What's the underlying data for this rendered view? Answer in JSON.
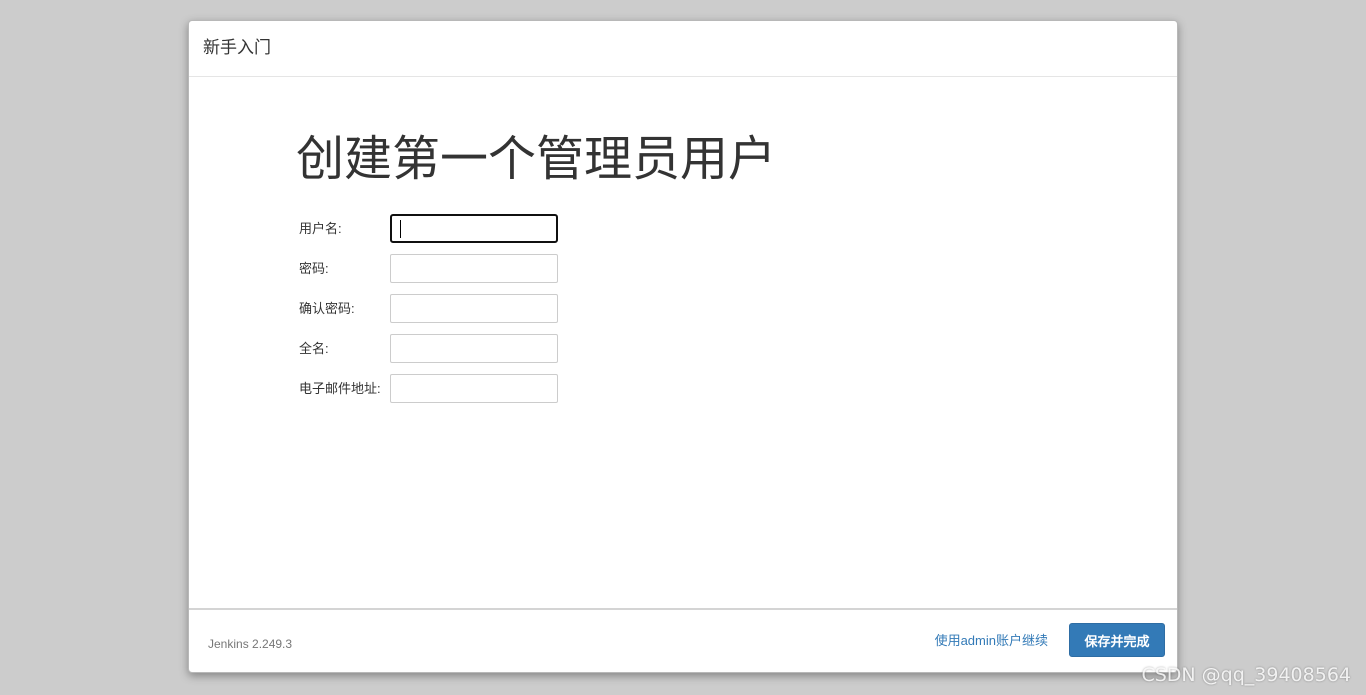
{
  "dialog": {
    "title": "新手入门",
    "heading": "创建第一个管理员用户",
    "fields": [
      {
        "label": "用户名:",
        "value": "",
        "focused": true
      },
      {
        "label": "密码:",
        "value": ""
      },
      {
        "label": "确认密码:",
        "value": ""
      },
      {
        "label": "全名:",
        "value": ""
      },
      {
        "label": "电子邮件地址:",
        "value": ""
      }
    ],
    "footer": {
      "version": "Jenkins 2.249.3",
      "continue_link": "使用admin账户继续",
      "save_button": "保存并完成"
    }
  },
  "watermark": "CSDN @qq_39408564",
  "colors": {
    "primary": "#337ab7",
    "background": "#cccccc"
  }
}
